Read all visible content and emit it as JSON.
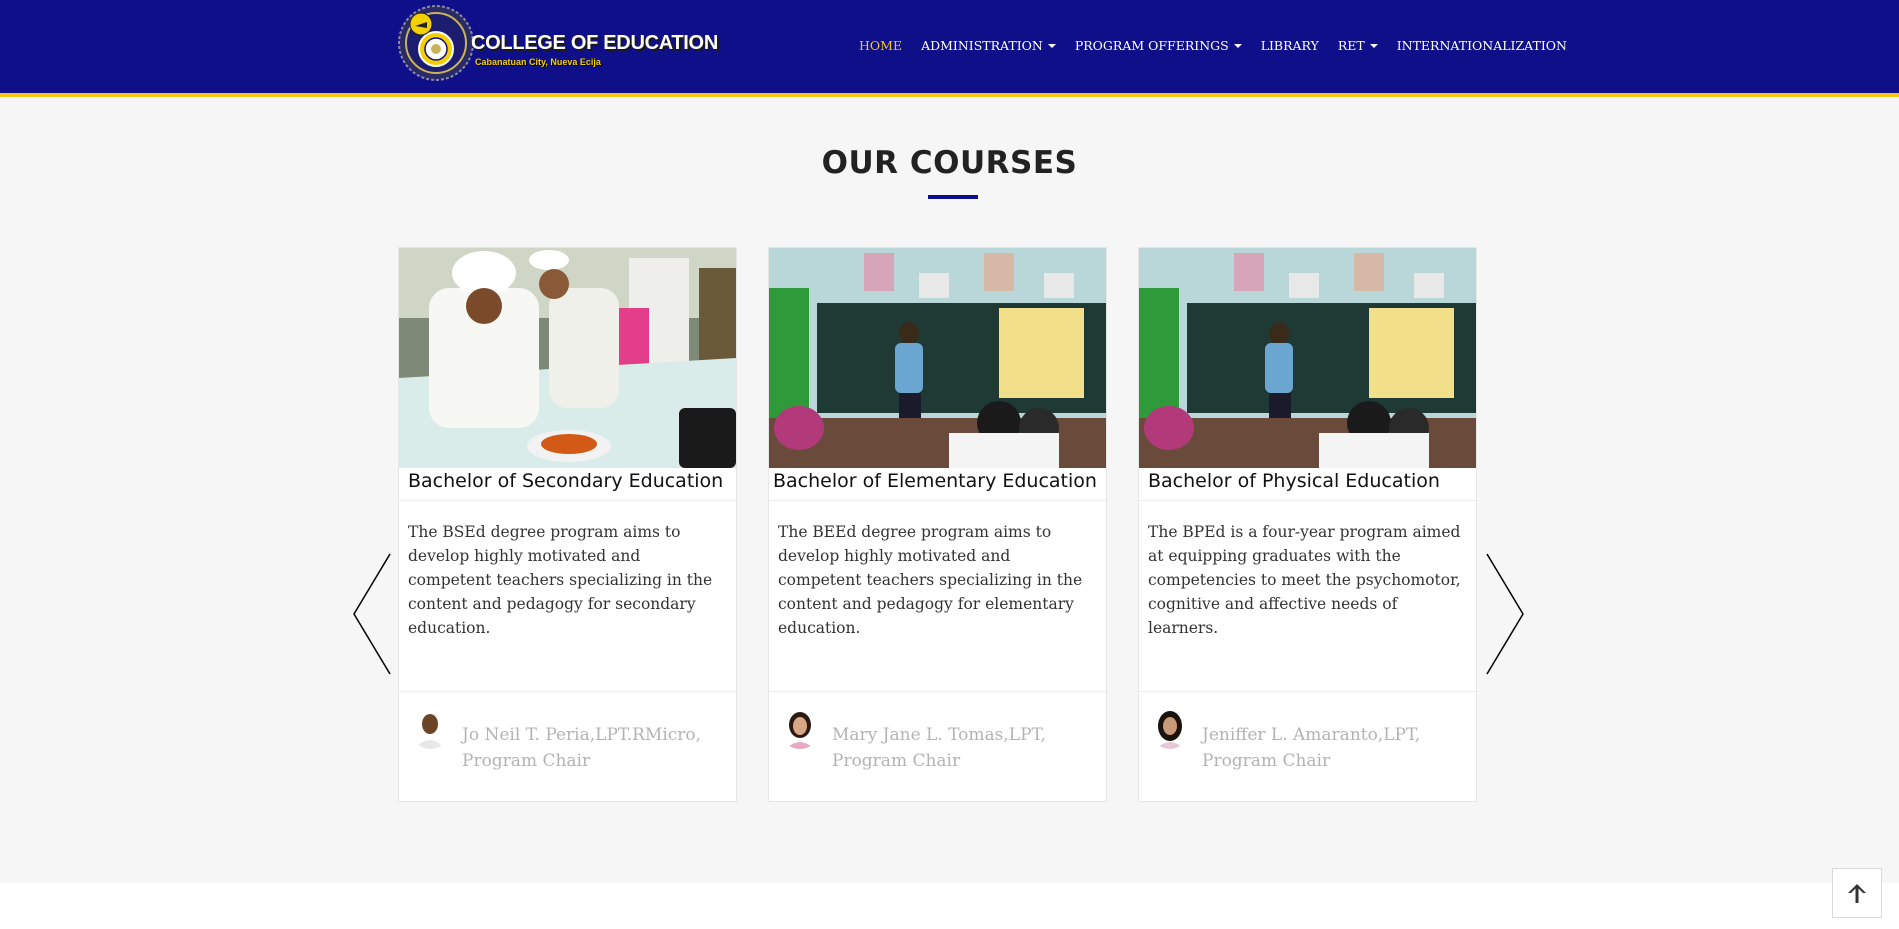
{
  "header": {
    "brand_title": "COLLEGE OF EDUCATION",
    "brand_subtitle": "Cabanatuan City, Nueva Ecija",
    "nav": [
      {
        "label": "HOME",
        "active": true,
        "dropdown": false
      },
      {
        "label": "ADMINISTRATION",
        "active": false,
        "dropdown": true
      },
      {
        "label": "PROGRAM OFFERINGS",
        "active": false,
        "dropdown": true
      },
      {
        "label": "LIBRARY",
        "active": false,
        "dropdown": false
      },
      {
        "label": "RET",
        "active": false,
        "dropdown": true
      },
      {
        "label": "INTERNATIONALIZATION",
        "active": false,
        "dropdown": false
      }
    ],
    "colors": {
      "background": "#0f0f8a",
      "accent": "#f5c518",
      "active_link": "#f5c518"
    }
  },
  "courses": {
    "title": "OUR COURSES",
    "cards": [
      {
        "name": "Bachelor of Secondary Education",
        "description": "The BSEd degree program aims to develop highly motivated and competent teachers specializing in the content and pedagogy for secondary education.",
        "chair": "Jo Neil T. Peria,LPT.RMicro, Program Chair",
        "image": "cooking-class-photo"
      },
      {
        "name": "Bachelor of Elementary Education",
        "description": "The BEEd degree program aims to develop highly motivated and competent teachers specializing in the content and pedagogy for elementary education.",
        "chair": "Mary Jane L. Tomas,LPT, Program Chair",
        "image": "classroom-blackboard-photo"
      },
      {
        "name": "Bachelor of Physical Education",
        "description": "The BPEd is a four-year program aimed at equipping graduates with the competencies to meet the psychomotor, cognitive and affective needs of learners.",
        "chair": "Jeniffer L. Amaranto,LPT, Program Chair",
        "image": "classroom-blackboard-photo"
      }
    ],
    "prev_icon": "chevron-left-icon",
    "next_icon": "chevron-right-icon"
  },
  "scroll_top_icon": "arrow-up-icon"
}
